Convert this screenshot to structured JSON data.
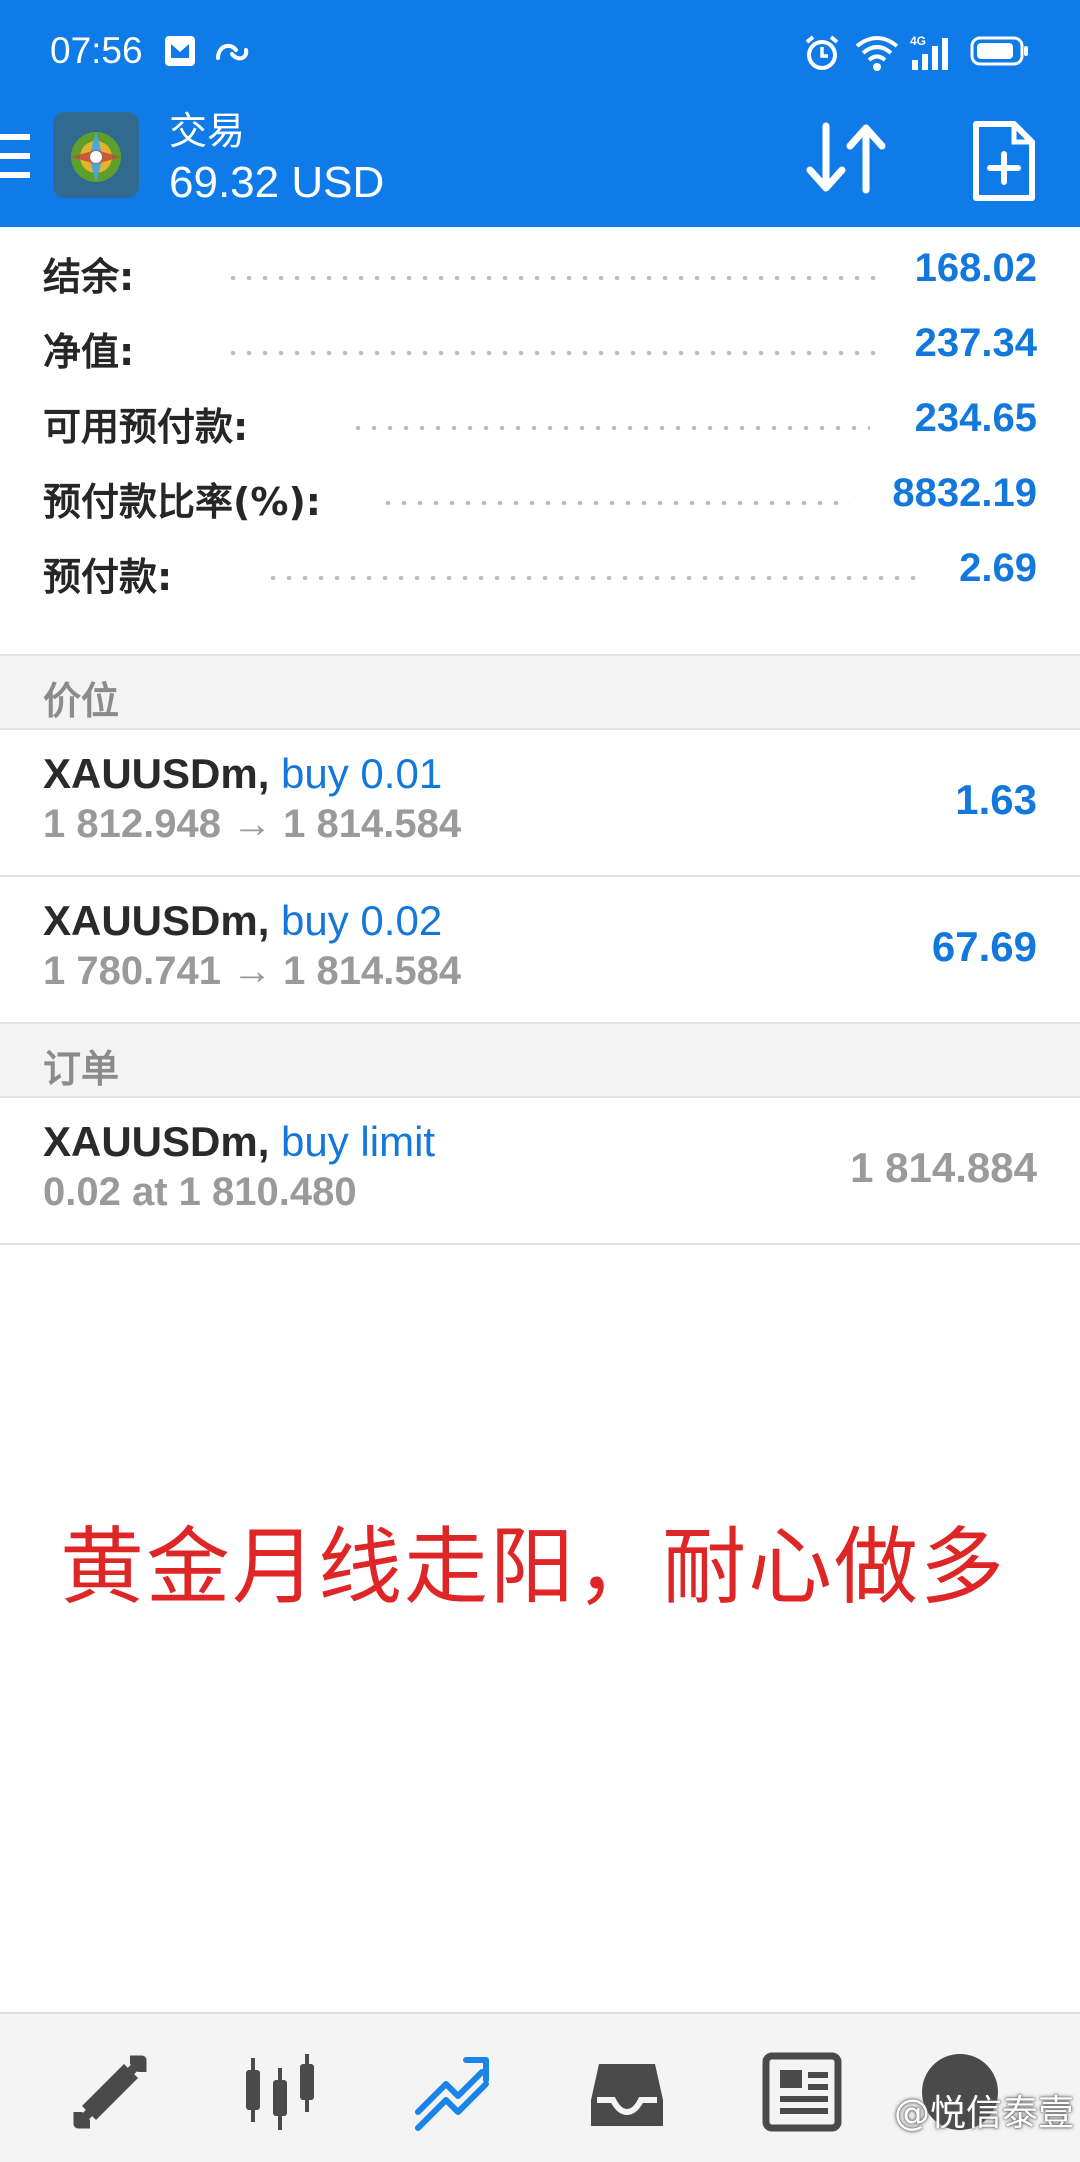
{
  "status_bar": {
    "time": "07:56",
    "icons": [
      "mail-icon",
      "link-icon",
      "alarm-icon",
      "wifi-icon",
      "signal-4g-icon",
      "battery-icon"
    ]
  },
  "header": {
    "title": "交易",
    "balance": "69.32 USD",
    "actions": [
      "sort-icon",
      "new-order-icon"
    ],
    "accent_color": "#0f7be8"
  },
  "summary": [
    {
      "label": "结余:",
      "value": "168.02"
    },
    {
      "label": "净值:",
      "value": "237.34"
    },
    {
      "label": "可用预付款:",
      "value": "234.65"
    },
    {
      "label": "预付款比率(%):",
      "value": "8832.19"
    },
    {
      "label": "预付款:",
      "value": "2.69"
    }
  ],
  "positions_header": "价位",
  "positions": [
    {
      "symbol": "XAUUSDm,",
      "type": "buy 0.01",
      "prices": "1 812.948 → 1 814.584",
      "profit": "1.63"
    },
    {
      "symbol": "XAUUSDm,",
      "type": "buy 0.02",
      "prices": "1 780.741 → 1 814.584",
      "profit": "67.69"
    }
  ],
  "orders_header": "订单",
  "orders": [
    {
      "symbol": "XAUUSDm,",
      "type": "buy limit",
      "details": "0.02 at 1 810.480",
      "price": "1 814.884"
    }
  ],
  "overlay_text": "黄金月线走阳，耐心做多",
  "bottom_nav": {
    "items": [
      "quotes-icon",
      "chart-icon",
      "trade-icon",
      "history-icon",
      "news-icon",
      "messages-icon"
    ],
    "active": "trade-icon"
  },
  "watermark": "@悦信泰壹"
}
